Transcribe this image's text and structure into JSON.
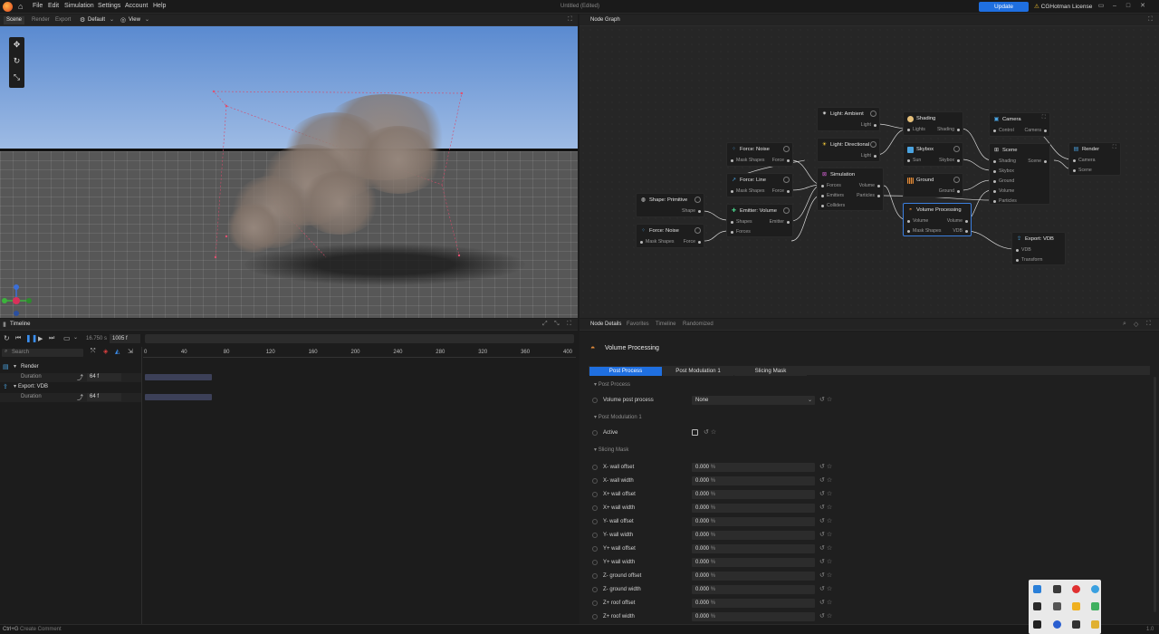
{
  "menu": {
    "items": [
      "File",
      "Edit",
      "Simulation",
      "Settings",
      "Account",
      "Help"
    ],
    "title": "Untitled (Edited)",
    "update_label": "Update",
    "license_label": "CGHotman License"
  },
  "viewport_header": {
    "tabs": [
      "Scene",
      "Render",
      "Export"
    ],
    "preset": "Default",
    "view": "View"
  },
  "nodegraph_header": {
    "title": "Node Graph"
  },
  "nodes": {
    "ambient": {
      "title": "Light: Ambient",
      "out": "Light"
    },
    "directional": {
      "title": "Light: Directional",
      "out": "Light"
    },
    "shading": {
      "title": "Shading",
      "in": "Lights",
      "out": "Shading"
    },
    "skybox": {
      "title": "Skybox",
      "in": "Sun",
      "out": "Skybox"
    },
    "ground": {
      "title": "Ground",
      "out": "Ground"
    },
    "camera": {
      "title": "Camera",
      "in": "Control",
      "out": "Camera"
    },
    "scene": {
      "title": "Scene",
      "ins": [
        "Shading",
        "Skybox",
        "Ground",
        "Volume",
        "Particles"
      ],
      "out": "Scene"
    },
    "render": {
      "title": "Render",
      "ins": [
        "Camera",
        "Scene"
      ]
    },
    "noise1": {
      "title": "Force: Noise",
      "in": "Mask Shapes",
      "out": "Force"
    },
    "line": {
      "title": "Force: Line",
      "in": "Mask Shapes",
      "out": "Force"
    },
    "emitter": {
      "title": "Emitter: Volume",
      "ins": [
        "Shapes",
        "Forces"
      ],
      "out": "Emitter"
    },
    "primitive": {
      "title": "Shape: Primitive",
      "out": "Shape"
    },
    "noise2": {
      "title": "Force: Noise",
      "in": "Mask Shapes",
      "out": "Force"
    },
    "simulation": {
      "title": "Simulation",
      "ins": [
        "Forces",
        "Emitters",
        "Colliders"
      ],
      "outs": [
        "Volume",
        "Particles"
      ]
    },
    "volproc": {
      "title": "Volume Processing",
      "ins": [
        "Volume",
        "Mask Shapes"
      ],
      "outs": [
        "Volume",
        "VDB"
      ]
    },
    "export": {
      "title": "Export: VDB",
      "ins": [
        "VDB",
        "Transform"
      ]
    }
  },
  "timeline": {
    "title": "Timeline",
    "time": "16.750 s",
    "frame": "1005 f",
    "search_placeholder": "Search",
    "ruler": [
      "0",
      "40",
      "80",
      "120",
      "160",
      "200",
      "240",
      "280",
      "320",
      "360",
      "400"
    ],
    "tracks": [
      {
        "name": "Render",
        "duration_label": "Duration",
        "duration": "64 f"
      },
      {
        "name": "Export: VDB",
        "duration_label": "Duration",
        "duration": "64 f"
      }
    ]
  },
  "details": {
    "tabs": [
      "Node Details",
      "Favorites",
      "Timeline",
      "Randomized"
    ],
    "node_title": "Volume Processing",
    "subtabs": [
      "Post Process",
      "Post Modulation 1",
      "Slicing Mask"
    ],
    "sections": {
      "post_process": "Post Process",
      "post_mod": "Post Modulation 1",
      "slicing": "Slicing Mask"
    },
    "volume_post_label": "Volume post process",
    "volume_post_value": "None",
    "active_label": "Active",
    "unit": "%",
    "slicing_rows": [
      {
        "label": "X- wall offset",
        "value": "0.000"
      },
      {
        "label": "X- wall width",
        "value": "0.000"
      },
      {
        "label": "X+ wall offset",
        "value": "0.000"
      },
      {
        "label": "X+ wall width",
        "value": "0.000"
      },
      {
        "label": "Y- wall offset",
        "value": "0.000"
      },
      {
        "label": "Y- wall width",
        "value": "0.000"
      },
      {
        "label": "Y+ wall offset",
        "value": "0.000"
      },
      {
        "label": "Y+ wall width",
        "value": "0.000"
      },
      {
        "label": "Z- ground offset",
        "value": "0.000"
      },
      {
        "label": "Z- ground width",
        "value": "0.000"
      },
      {
        "label": "Z+ roof offset",
        "value": "0.000"
      },
      {
        "label": "Z+ roof width",
        "value": "0.000"
      }
    ]
  },
  "status": {
    "shortcut": "Ctrl+G",
    "hint": "Create Comment",
    "version": "1.0"
  },
  "colors": {
    "accent": "#1f6fe0",
    "selected_node": "#3b7fe0"
  }
}
